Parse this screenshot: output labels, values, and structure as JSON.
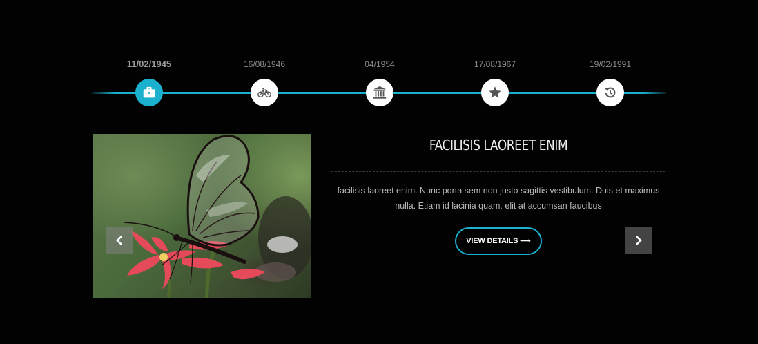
{
  "timeline": {
    "items": [
      {
        "date": "11/02/1945",
        "icon": "briefcase-icon",
        "active": true
      },
      {
        "date": "16/08/1946",
        "icon": "bicycle-icon",
        "active": false
      },
      {
        "date": "04/1954",
        "icon": "bank-icon",
        "active": false
      },
      {
        "date": "17/08/1967",
        "icon": "star-icon",
        "active": false
      },
      {
        "date": "19/02/1991",
        "icon": "history-icon",
        "active": false
      }
    ],
    "accent_color": "#1bb0ce"
  },
  "slide": {
    "title": "FACILISIS LAOREET ENIM",
    "text": "facilisis laoreet enim. Nunc porta sem non justo sagittis vestibulum. Duis et maximus nulla. Etiam id lacinia quam. elit at accumsan faucibus",
    "button_label": "VIEW DETAILS ⟶",
    "image": "butterfly-photo"
  },
  "nav": {
    "prev_icon": "chevron-left-icon",
    "next_icon": "chevron-right-icon"
  }
}
